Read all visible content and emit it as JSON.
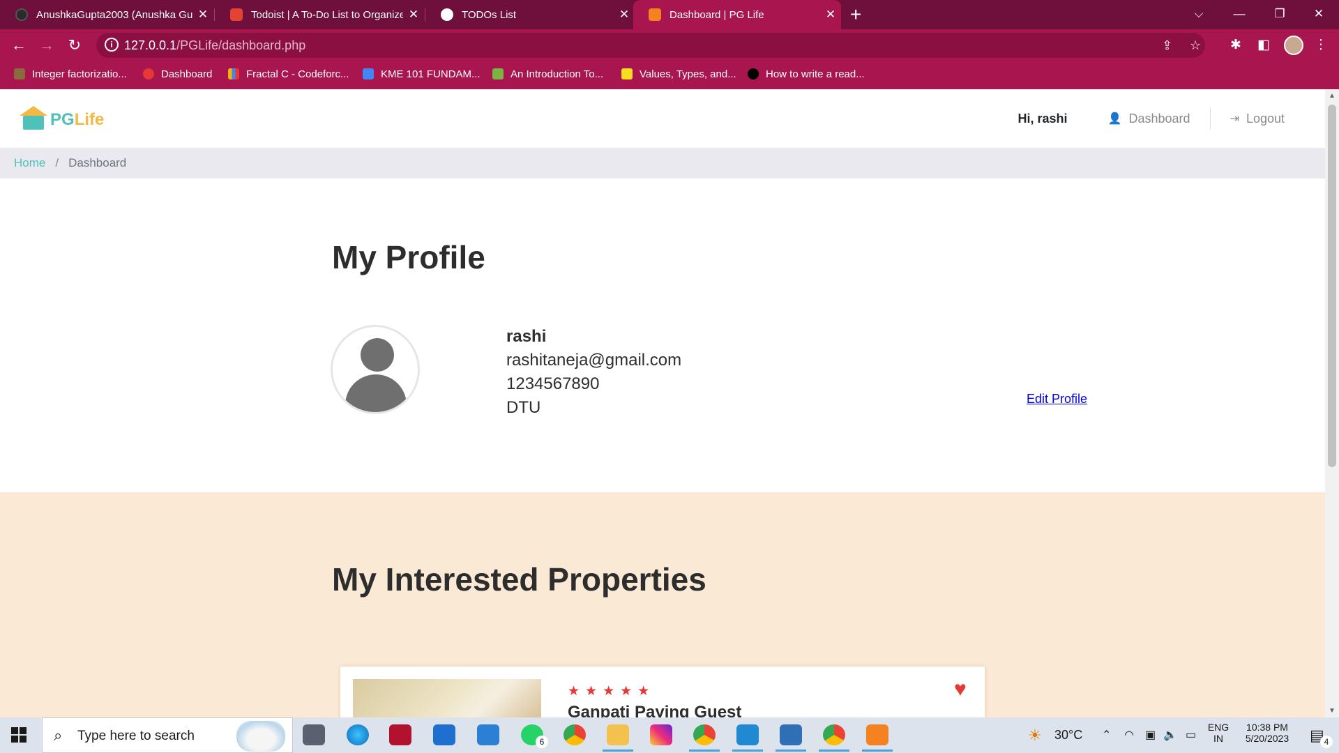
{
  "browser": {
    "tabs": [
      {
        "label": "AnushkaGupta2003 (Anushka Gu",
        "favicon_color": "#2b2b2b",
        "active": false
      },
      {
        "label": "Todoist | A To-Do List to Organize",
        "favicon_color": "#e44332",
        "active": false
      },
      {
        "label": "TODOs List",
        "favicon_color": "#ffffff",
        "active": false
      },
      {
        "label": "Dashboard | PG Life",
        "favicon_color": "#f58220",
        "active": true
      }
    ],
    "close_glyph": "✕",
    "new_tab_glyph": "+",
    "url_host": "127.0.0.1",
    "url_path": "/PGLife/dashboard.php",
    "bookmarks": [
      {
        "label": "Integer factorizatio...",
        "favicon_color": "#8b6b3d"
      },
      {
        "label": "Dashboard",
        "favicon_color": "#e53935"
      },
      {
        "label": "Fractal C - Codeforc...",
        "favicon_color": "#f4b400"
      },
      {
        "label": "KME 101 FUNDAM...",
        "favicon_color": "#4285f4"
      },
      {
        "label": "An Introduction To...",
        "favicon_color": "#7cb342"
      },
      {
        "label": "Values, Types, and...",
        "favicon_color": "#f7df1e"
      },
      {
        "label": "How to write a read...",
        "favicon_color": "#000000"
      }
    ]
  },
  "site": {
    "logo_pg": "PG",
    "logo_life": "Life",
    "greeting": "Hi, rashi",
    "nav_dashboard": "Dashboard",
    "nav_logout": "Logout",
    "brand_teal": "#4fc1b8",
    "brand_yellow": "#f4b942"
  },
  "breadcrumb": {
    "home": "Home",
    "separator": "/",
    "current": "Dashboard"
  },
  "profile": {
    "title": "My Profile",
    "name": "rashi",
    "email": "rashitaneja@gmail.com",
    "phone": "1234567890",
    "college": "DTU",
    "edit_label": "Edit Profile"
  },
  "interested": {
    "title": "My Interested Properties",
    "bg_color": "#fae9d4",
    "properties": [
      {
        "name": "Ganpati Paying Guest",
        "rating_stars": 5,
        "star_glyphs": "★★★★★",
        "heart_glyph": "♥",
        "interested": true
      }
    ]
  },
  "taskbar": {
    "search_placeholder": "Type here to search",
    "whatsapp_badge": "6",
    "notification_badge": "4",
    "temperature": "30°C",
    "lang_top": "ENG",
    "lang_bottom": "IN",
    "time": "10:38 PM",
    "date": "5/20/2023"
  }
}
